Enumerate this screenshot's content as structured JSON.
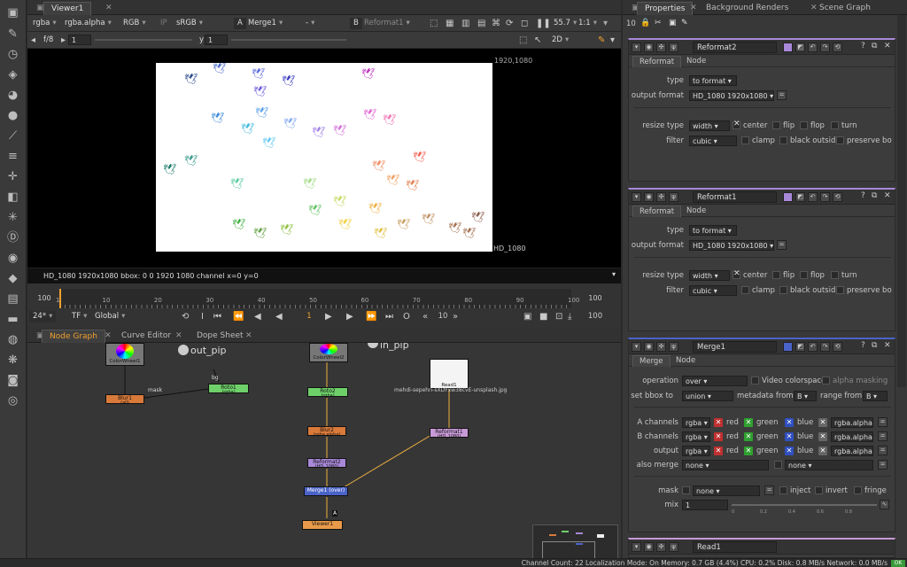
{
  "viewer": {
    "tab": "Viewer1",
    "channels": "rgba",
    "alpha_channel": "rgba.alpha",
    "display": "RGB",
    "ip": "IP",
    "colorspace": "sRGB",
    "a_label": "A",
    "a_input": "Merge1",
    "dash": "-",
    "b_label": "B",
    "b_input": "Reformat1",
    "zoom": "55.7",
    "ratio": "1:1",
    "fstop": "f/8",
    "gain_value": "1",
    "y_label": "y",
    "gamma_value": "1",
    "view_mode": "2D",
    "format_top": "1920,1080",
    "format_bottom": "HD_1080",
    "info_line": "HD_1080 1920x1080  bbox: 0 0 1920 1080 channel  x=0 y=0"
  },
  "timeline": {
    "start": "100",
    "end": "100",
    "ticks": [
      "1",
      "10",
      "20",
      "30",
      "40",
      "50",
      "60",
      "70",
      "80",
      "90",
      "100"
    ],
    "fps": "24*",
    "tf": "TF",
    "scope": "Global",
    "current_frame": "1",
    "increment": "10",
    "end_frame": "100",
    "playhead_fraction": 0.0
  },
  "nodegraph": {
    "tabs": [
      "Node Graph",
      "Curve Editor",
      "Dope Sheet"
    ],
    "nodes": {
      "colorwheel1": "ColorWheel1",
      "colorwheel2": "ColorWheel2",
      "blur1": "Blur1",
      "blur1_sub": "(all)",
      "roto1": "Roto1",
      "roto1_sub": "(rgba)",
      "roto2": "Roto2",
      "roto2_sub": "(rgba)",
      "blur2": "Blur2",
      "blur2_sub": "(rgba.alpha)",
      "reformat2": "Reformat2",
      "reformat2_sub": "(HD_1080)",
      "merge1": "Merge1 (over)",
      "viewer1": "Viewer1",
      "read1": "Read1",
      "read1_sub": "(HD_1080)",
      "read1_file": "mehdi-sepehri-sXDYxw38cvE-unsplash.jpg",
      "reformat1": "Reformat1",
      "reformat1_sub": "(HD_1080)",
      "out_pip": "out_pip",
      "in_pip": "in_pip",
      "mask_label": "mask",
      "bg_label": "bg",
      "a_label": "A"
    }
  },
  "properties": {
    "tabs": [
      "Properties",
      "Background Renders",
      "Scene Graph"
    ],
    "max_panels": "10",
    "reformat2": {
      "name": "Reformat2",
      "tabs": [
        "Reformat",
        "Node"
      ],
      "type_label": "type",
      "type_value": "to format",
      "output_format_label": "output format",
      "output_format_value": "HD_1080 1920x1080",
      "resize_type_label": "resize type",
      "resize_type_value": "width",
      "center": "center",
      "flip": "flip",
      "flop": "flop",
      "turn": "turn",
      "filter_label": "filter",
      "filter_value": "cubic",
      "clamp": "clamp",
      "black_outside": "black outsid",
      "preserve": "preserve bo"
    },
    "reformat1": {
      "name": "Reformat1",
      "tabs": [
        "Reformat",
        "Node"
      ],
      "type_label": "type",
      "type_value": "to format",
      "output_format_label": "output format",
      "output_format_value": "HD_1080 1920x1080",
      "resize_type_label": "resize type",
      "resize_type_value": "width",
      "center": "center",
      "flip": "flip",
      "flop": "flop",
      "turn": "turn",
      "filter_label": "filter",
      "filter_value": "cubic",
      "clamp": "clamp",
      "black_outside": "black outsid",
      "preserve": "preserve bo"
    },
    "merge1": {
      "name": "Merge1",
      "tabs": [
        "Merge",
        "Node"
      ],
      "operation_label": "operation",
      "operation_value": "over",
      "video_colorspace": "Video colorspace",
      "alpha_masking": "alpha masking",
      "bbox_label": "set bbox to",
      "bbox_value": "union",
      "metadata_label": "metadata from",
      "metadata_value": "B",
      "range_label": "range from",
      "range_value": "B",
      "a_channels_label": "A channels",
      "b_channels_label": "B channels",
      "output_label": "output",
      "rgba": "rgba",
      "red": "red",
      "green": "green",
      "blue": "blue",
      "rgba_alpha": "rgba.alpha",
      "also_merge_label": "also merge",
      "none": "none",
      "mask_label": "mask",
      "inject": "inject",
      "invert": "invert",
      "fringe": "fringe",
      "mix_label": "mix",
      "mix_value": "1",
      "mix_ticks": [
        "0",
        "0.2",
        "0.4",
        "0.6",
        "0.8"
      ]
    },
    "read1": {
      "name": "Read1"
    }
  },
  "status": {
    "text": "Channel Count: 22  Localization Mode: On  Memory: 0.7 GB (4.4%)  CPU: 0.2%  Disk: 0.8 MB/s  Network: 0.0 MB/s"
  },
  "colors": {
    "accent_orange": "#f0a030",
    "blur_node": "#d97a3a",
    "roto_node": "#6fd06a",
    "reformat_node": "#a888d8",
    "merge_node": "#4a63c8",
    "viewer_node": "#e89a4a",
    "read_node": "#c89ad8"
  }
}
